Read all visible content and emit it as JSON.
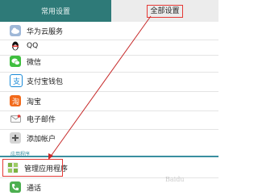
{
  "tabs": {
    "common": "常用设置",
    "all": "全部设置"
  },
  "items": [
    {
      "label": "华为云服务",
      "icon": "cloud-icon"
    },
    {
      "label": "QQ",
      "icon": "qq-penguin-icon"
    },
    {
      "label": "微信",
      "icon": "wechat-icon"
    },
    {
      "label": "支付宝钱包",
      "icon": "alipay-icon"
    },
    {
      "label": "淘宝",
      "icon": "taobao-icon"
    },
    {
      "label": "电子邮件",
      "icon": "email-icon"
    },
    {
      "label": "添加帐户",
      "icon": "add-icon"
    }
  ],
  "section": {
    "title": "应用程序"
  },
  "app_items": [
    {
      "label": "管理应用程序",
      "icon": "apps-grid-icon"
    },
    {
      "label": "通话",
      "icon": "phone-icon"
    }
  ],
  "colors": {
    "tab_active": "#2e7a78",
    "accent": "#3a8fa0",
    "annotation": "#e53935"
  }
}
